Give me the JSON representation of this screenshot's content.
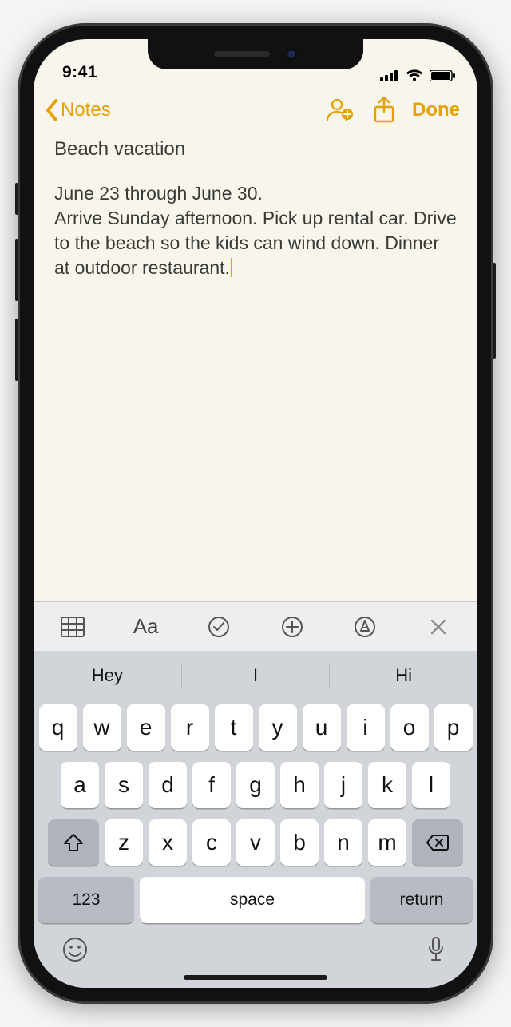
{
  "status": {
    "time": "9:41"
  },
  "nav": {
    "back_label": "Notes",
    "done_label": "Done"
  },
  "note": {
    "title": "Beach vacation",
    "body": "June 23 through June 30.\nArrive Sunday afternoon. Pick up rental car. Drive to the beach so the kids can wind down. Dinner at outdoor restaurant."
  },
  "format_bar": {
    "text_style_label": "Aa"
  },
  "keyboard": {
    "suggestions": [
      "Hey",
      "I",
      "Hi"
    ],
    "row1": [
      "q",
      "w",
      "e",
      "r",
      "t",
      "y",
      "u",
      "i",
      "o",
      "p"
    ],
    "row2": [
      "a",
      "s",
      "d",
      "f",
      "g",
      "h",
      "j",
      "k",
      "l"
    ],
    "row3": [
      "z",
      "x",
      "c",
      "v",
      "b",
      "n",
      "m"
    ],
    "numeric_label": "123",
    "space_label": "space",
    "return_label": "return"
  }
}
